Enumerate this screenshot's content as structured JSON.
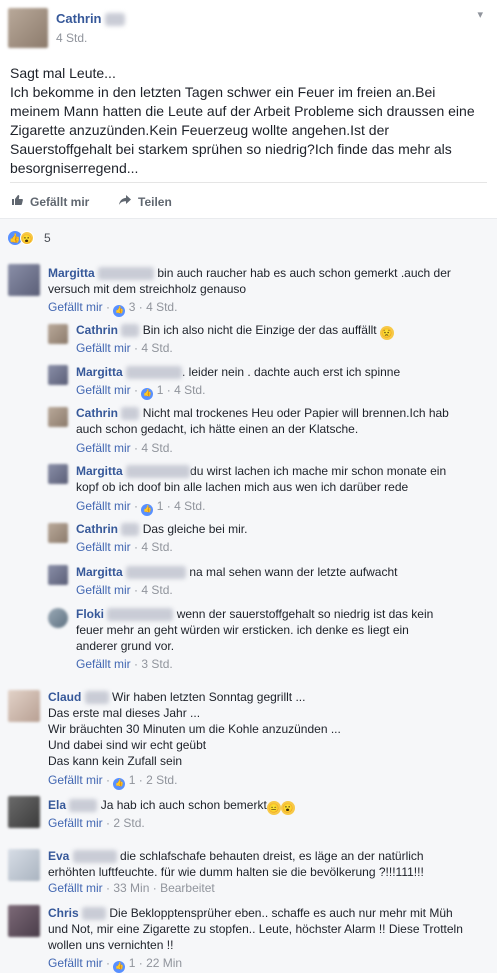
{
  "post": {
    "author": "Cathrin",
    "time": "4 Std.",
    "caret": "▾",
    "text_lines": [
      "Sagt mal Leute...",
      "Ich bekomme in den letzten Tagen schwer ein Feuer im freien an.Bei",
      "meinem Mann hatten die Leute auf der Arbeit Probleme sich draussen eine",
      "Zigarette anzuzünden.Kein Feuerzeug wollte angehen.Ist der",
      "Sauerstoffgehalt bei starkem sprühen so niedrig?Ich finde das mehr als",
      "besorgniserregend..."
    ],
    "like_label": "Gefällt mir",
    "share_label": "Teilen",
    "reaction_count": "5"
  },
  "comments": [
    {
      "name": "Margitta",
      "lines": [
        "bin auch raucher hab es auch schon gemerkt .auch der",
        "versuch mit dem streichholz genauso"
      ],
      "like": "Gefällt mir",
      "likes": "3",
      "time": "4 Std."
    },
    {
      "name": "Cathrin",
      "lines": [
        "Bin ich also nicht die Einzige der das auffällt"
      ],
      "like": "Gefällt mir",
      "likes": "",
      "time": "4 Std.",
      "emoji": "😟"
    },
    {
      "name": "Margitta",
      "lines": [
        ". leider nein . dachte auch erst ich spinne"
      ],
      "like": "Gefällt mir",
      "likes": "1",
      "time": "4 Std."
    },
    {
      "name": "Cathrin",
      "lines": [
        "Nicht mal trockenes Heu oder Papier will brennen.Ich hab",
        "auch schon gedacht, ich hätte einen an der Klatsche."
      ],
      "like": "Gefällt mir",
      "likes": "",
      "time": "4 Std."
    },
    {
      "name": "Margitta",
      "lines": [
        "du wirst lachen ich mache mir schon monate ein",
        "kopf ob ich doof bin alle lachen mich aus wen ich darüber rede"
      ],
      "like": "Gefällt mir",
      "likes": "1",
      "time": "4 Std."
    },
    {
      "name": "Cathrin",
      "lines": [
        "Das gleiche bei mir."
      ],
      "like": "Gefällt mir",
      "likes": "",
      "time": "4 Std."
    },
    {
      "name": "Margitta",
      "lines": [
        "na mal sehen wann der letzte aufwacht"
      ],
      "like": "Gefällt mir",
      "likes": "",
      "time": "4 Std."
    },
    {
      "name": "Floki",
      "lines": [
        "wenn der sauerstoffgehalt so niedrig ist das kein",
        "feuer mehr an geht würden wir ersticken. ich denke es liegt ein",
        "anderer grund vor."
      ],
      "like": "Gefällt mir",
      "likes": "",
      "time": "3 Std."
    },
    {
      "name": "Claud",
      "lines": [
        "Wir haben letzten Sonntag gegrillt ...",
        "Das erste mal dieses Jahr ...",
        "Wir bräuchten 30 Minuten um die Kohle anzuzünden ...",
        "Und dabei sind wir echt geübt",
        "Das kann kein Zufall sein"
      ],
      "like": "Gefällt mir",
      "likes": "1",
      "time": "2 Std."
    },
    {
      "name": "Ela",
      "lines": [
        "Ja hab ich auch schon bemerkt"
      ],
      "like": "Gefällt mir",
      "likes": "",
      "time": "2 Std.",
      "emoji": "😑",
      "emoji2": "😮"
    },
    {
      "name": "Eva",
      "lines": [
        "die schlafschafe behauten dreist, es läge an der natürlich",
        "erhöhten luftfeuchte. für wie dumm halten sie die bevölkerung ?!!!111!!!"
      ],
      "like": "Gefällt mir",
      "likes": "",
      "time": "33 Min",
      "extra": "Bearbeitet"
    },
    {
      "name": "Chris",
      "lines": [
        "Die Beklopptensprüher eben.. schaffe es auch nur mehr mit Müh",
        "und Not, mir eine Zigarette zu stopfen.. Leute, höchster Alarm !! Diese Trotteln",
        "wollen uns vernichten !!"
      ],
      "like": "Gefällt mir",
      "likes": "1",
      "time": "22 Min"
    }
  ]
}
